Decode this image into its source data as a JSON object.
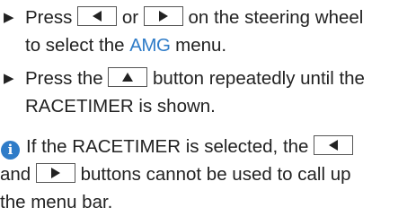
{
  "steps": [
    {
      "bullet": "▶",
      "part1": "Press",
      "part2": "or",
      "part3": "on the steering wheel",
      "part4": "to select the",
      "highlight": "AMG",
      "part5": "menu."
    },
    {
      "bullet": "▶",
      "part1": "Press the",
      "part2": "button repeatedly until the",
      "part3": "RACETIMER is shown."
    }
  ],
  "note": {
    "icon": "info-icon",
    "part1": "If the RACETIMER is selected, the",
    "part2": "and",
    "part3": "buttons cannot be used to call up",
    "part4": "the menu bar."
  },
  "keys": {
    "left": "left-arrow-key",
    "right": "right-arrow-key",
    "up": "up-arrow-key"
  },
  "colors": {
    "accent": "#2f7cc8",
    "text": "#222222"
  }
}
